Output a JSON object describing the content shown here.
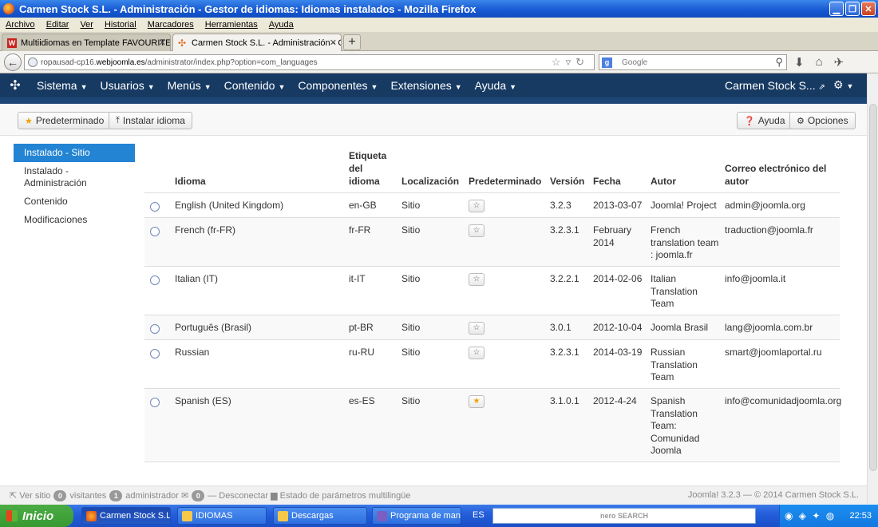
{
  "window": {
    "title": "Carmen Stock S.L. - Administración - Gestor de idiomas: Idiomas instalados - Mozilla Firefox"
  },
  "menubar": [
    "Archivo",
    "Editar",
    "Ver",
    "Historial",
    "Marcadores",
    "Herramientas",
    "Ayuda"
  ],
  "tabs": [
    {
      "label": "Multiidiomas en Template FAVOURITE Jo...",
      "active": false
    },
    {
      "label": "Carmen Stock S.L. - Administración - Ges...",
      "active": true
    }
  ],
  "address": {
    "prefix": "ropausad-cp16.",
    "domain": "webjoomla.es",
    "path": "/administrator/index.php?option=com_languages"
  },
  "search": {
    "placeholder": "Google",
    "engine_icon": "google-icon"
  },
  "joomla_nav": {
    "items": [
      "Sistema",
      "Usuarios",
      "Menús",
      "Contenido",
      "Componentes",
      "Extensiones",
      "Ayuda"
    ],
    "user": "Carmen Stock S..."
  },
  "toolbar": {
    "default_label": "Predeterminado",
    "install_label": "Instalar idioma",
    "help_label": "Ayuda",
    "options_label": "Opciones"
  },
  "sidebar": {
    "items": [
      {
        "label": "Instalado - Sitio",
        "active": true
      },
      {
        "label": "Instalado - Administración",
        "active": false
      },
      {
        "label": "Contenido",
        "active": false
      },
      {
        "label": "Modificaciones",
        "active": false
      }
    ]
  },
  "table": {
    "headers": {
      "language": "Idioma",
      "tag": "Etiqueta del idioma",
      "location": "Localización",
      "default": "Predeterminado",
      "version": "Versión",
      "date": "Fecha",
      "author": "Autor",
      "email": "Correo electrónico del autor"
    },
    "rows": [
      {
        "language": "English (United Kingdom)",
        "tag": "en-GB",
        "location": "Sitio",
        "default": false,
        "version": "3.2.3",
        "date": "2013-03-07",
        "author": "Joomla! Project",
        "email": "admin@joomla.org"
      },
      {
        "language": "French (fr-FR)",
        "tag": "fr-FR",
        "location": "Sitio",
        "default": false,
        "version": "3.2.3.1",
        "date": "February 2014",
        "author": "French translation team : joomla.fr",
        "email": "traduction@joomla.fr"
      },
      {
        "language": "Italian (IT)",
        "tag": "it-IT",
        "location": "Sitio",
        "default": false,
        "version": "3.2.2.1",
        "date": "2014-02-06",
        "author": "Italian Translation Team",
        "email": "info@joomla.it"
      },
      {
        "language": "Português (Brasil)",
        "tag": "pt-BR",
        "location": "Sitio",
        "default": false,
        "version": "3.0.1",
        "date": "2012-10-04",
        "author": "Joomla Brasil",
        "email": "lang@joomla.com.br"
      },
      {
        "language": "Russian",
        "tag": "ru-RU",
        "location": "Sitio",
        "default": false,
        "version": "3.2.3.1",
        "date": "2014-03-19",
        "author": "Russian Translation Team",
        "email": "smart@joomlaportal.ru"
      },
      {
        "language": "Spanish (ES)",
        "tag": "es-ES",
        "location": "Sitio",
        "default": true,
        "version": "3.1.0.1",
        "date": "2012-4-24",
        "author": "Spanish Translation Team: Comunidad Joomla",
        "email": "info@comunidadjoomla.org"
      }
    ]
  },
  "footer": {
    "view_site": "Ver sitio",
    "visitors_count": "0",
    "visitors_label": "visitantes",
    "admin_count": "1",
    "admin_label": "administrador",
    "msg_count": "0",
    "logout": "Desconectar",
    "multilang": "Estado de parámetros multilingüe",
    "copyright": "Joomla! 3.2.3 — © 2014 Carmen Stock S.L."
  },
  "taskbar": {
    "start": "Inicio",
    "items": [
      {
        "label": "Carmen Stock S.L....",
        "active": true
      },
      {
        "label": "IDIOMAS",
        "active": false
      },
      {
        "label": "Descargas",
        "active": false
      },
      {
        "label": "Programa de mani...",
        "active": false
      }
    ],
    "lang": "ES",
    "search_brand": "nero SEARCH",
    "clock": "22:53"
  }
}
